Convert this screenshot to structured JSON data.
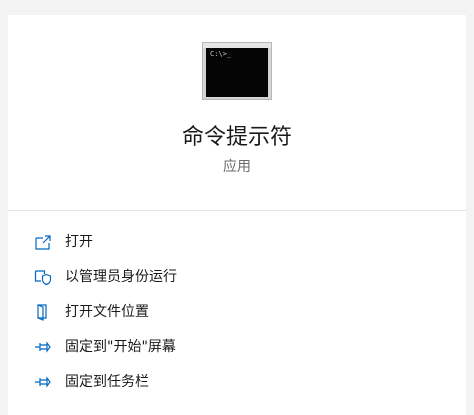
{
  "app": {
    "icon_name": "command-prompt-icon",
    "icon_prompt": "C:\\>_",
    "title": "命令提示符",
    "subtitle": "应用"
  },
  "menu": {
    "items": [
      {
        "label": "打开",
        "icon": "open-external-icon"
      },
      {
        "label": "以管理员身份运行",
        "icon": "shield-icon"
      },
      {
        "label": "打开文件位置",
        "icon": "file-location-icon"
      },
      {
        "label": "固定到\"开始\"屏幕",
        "icon": "pin-icon"
      },
      {
        "label": "固定到任务栏",
        "icon": "pin-icon"
      }
    ]
  },
  "colors": {
    "accent": "#0067c0",
    "panel_bg": "#ffffff",
    "page_bg": "#f3f3f3"
  }
}
